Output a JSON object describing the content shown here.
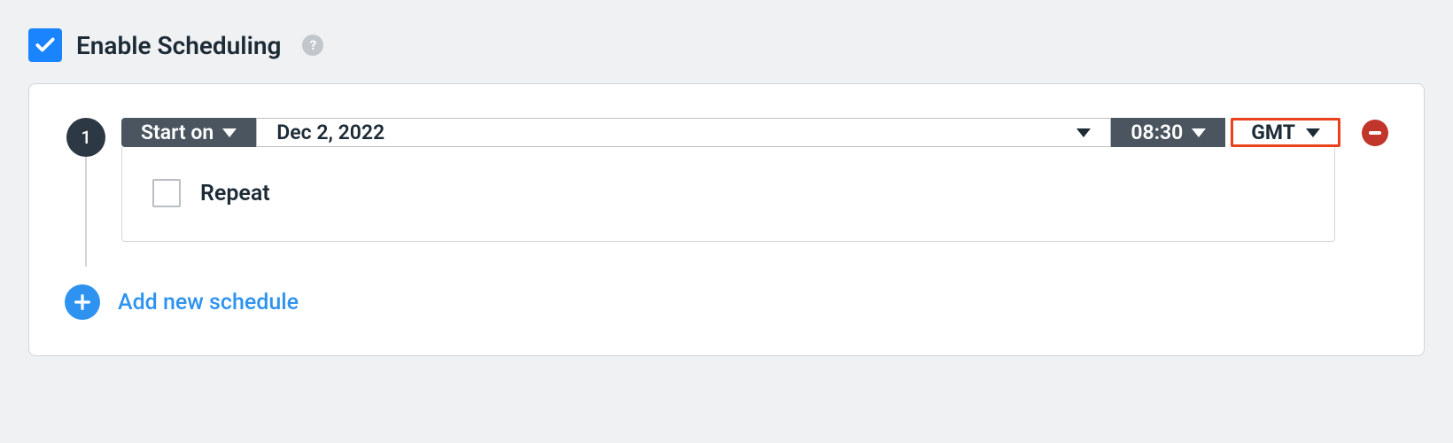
{
  "header": {
    "title": "Enable Scheduling",
    "enabled": true
  },
  "schedule": {
    "step": "1",
    "start_label": "Start on",
    "date": "Dec 2, 2022",
    "time": "08:30",
    "timezone": "GMT",
    "repeat_label": "Repeat",
    "repeat_checked": false
  },
  "actions": {
    "add_label": "Add new schedule"
  }
}
